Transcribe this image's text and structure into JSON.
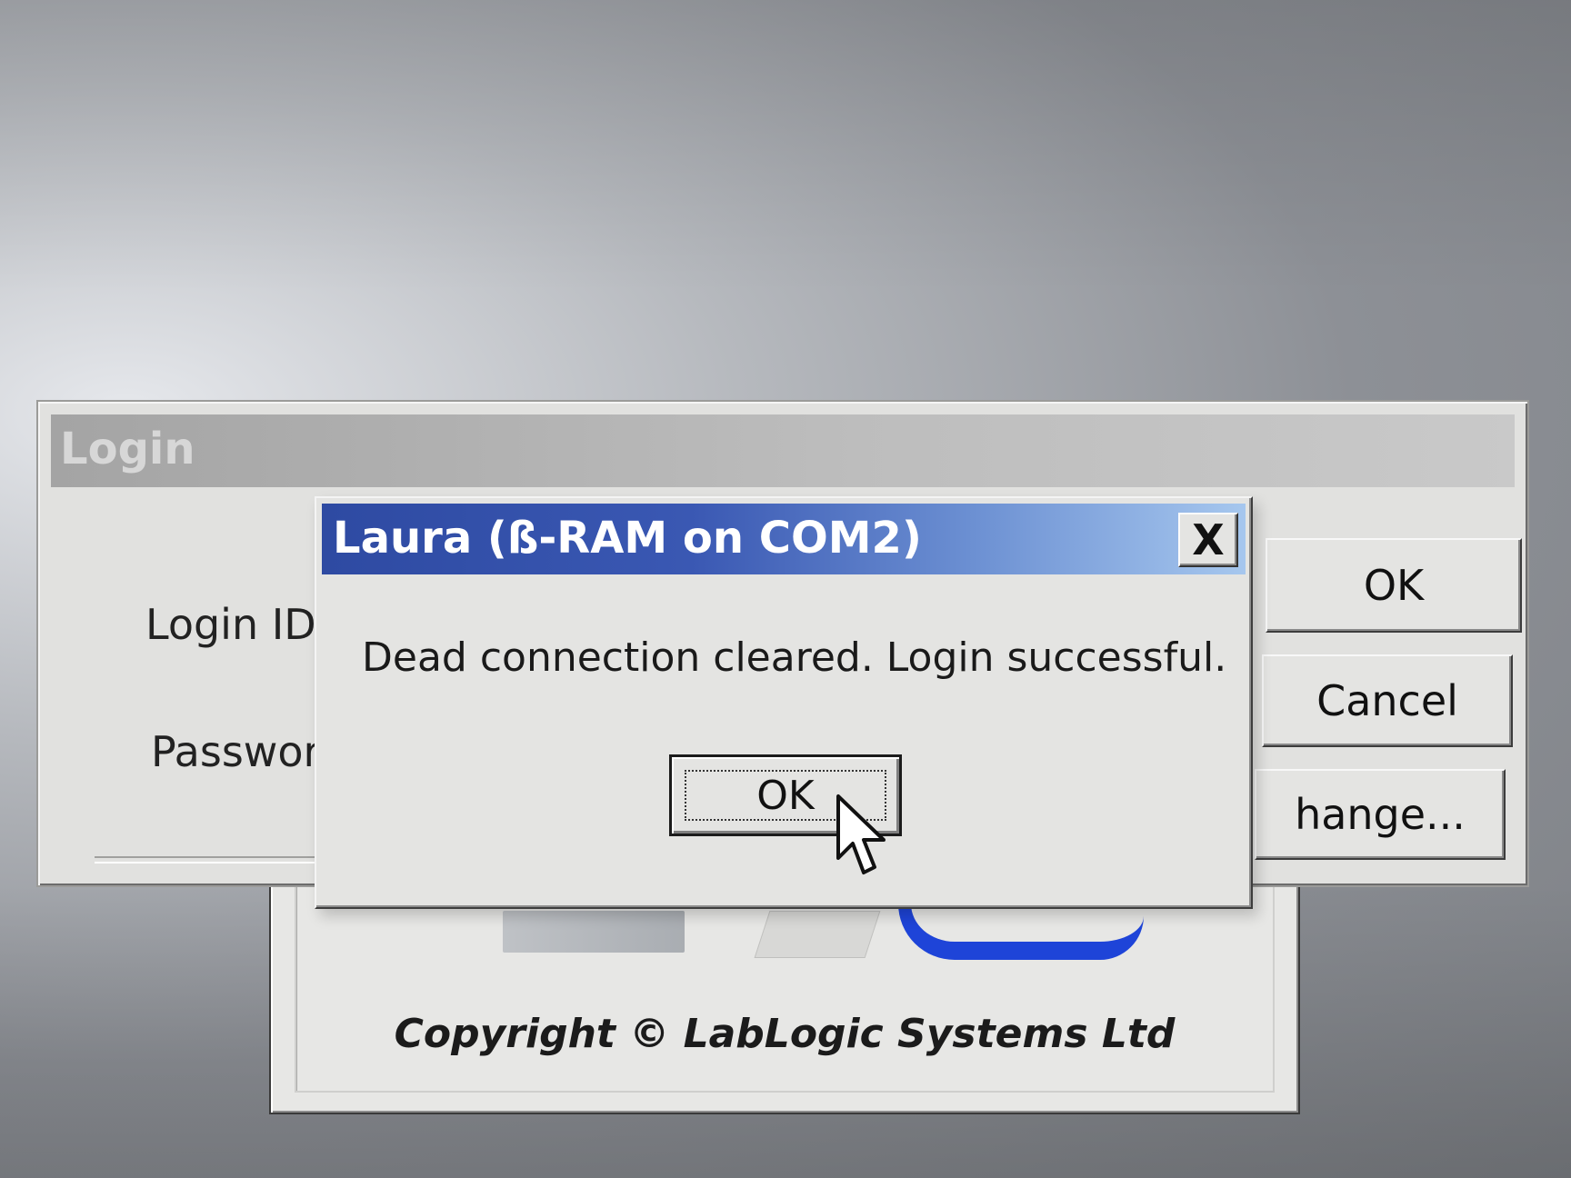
{
  "splash": {
    "copyright": "Copyright © LabLogic Systems Ltd"
  },
  "login_window": {
    "title": "Login",
    "login_id_label": "Login ID",
    "password_label": "Passwor",
    "buttons": {
      "ok": "OK",
      "cancel": "Cancel",
      "change": "hange..."
    }
  },
  "message_box": {
    "title": "Laura (ß-RAM on COM2)",
    "close_label": "X",
    "message": "Dead connection cleared. Login successful.",
    "ok_label": "OK"
  },
  "colors": {
    "titlebar_start": "#2e4aa2",
    "titlebar_end": "#a6c7ee",
    "logo_blue": "#1e44d8",
    "dialog_face": "#e4e4e2"
  },
  "icons": {
    "cursor": "arrow-cursor-icon"
  }
}
